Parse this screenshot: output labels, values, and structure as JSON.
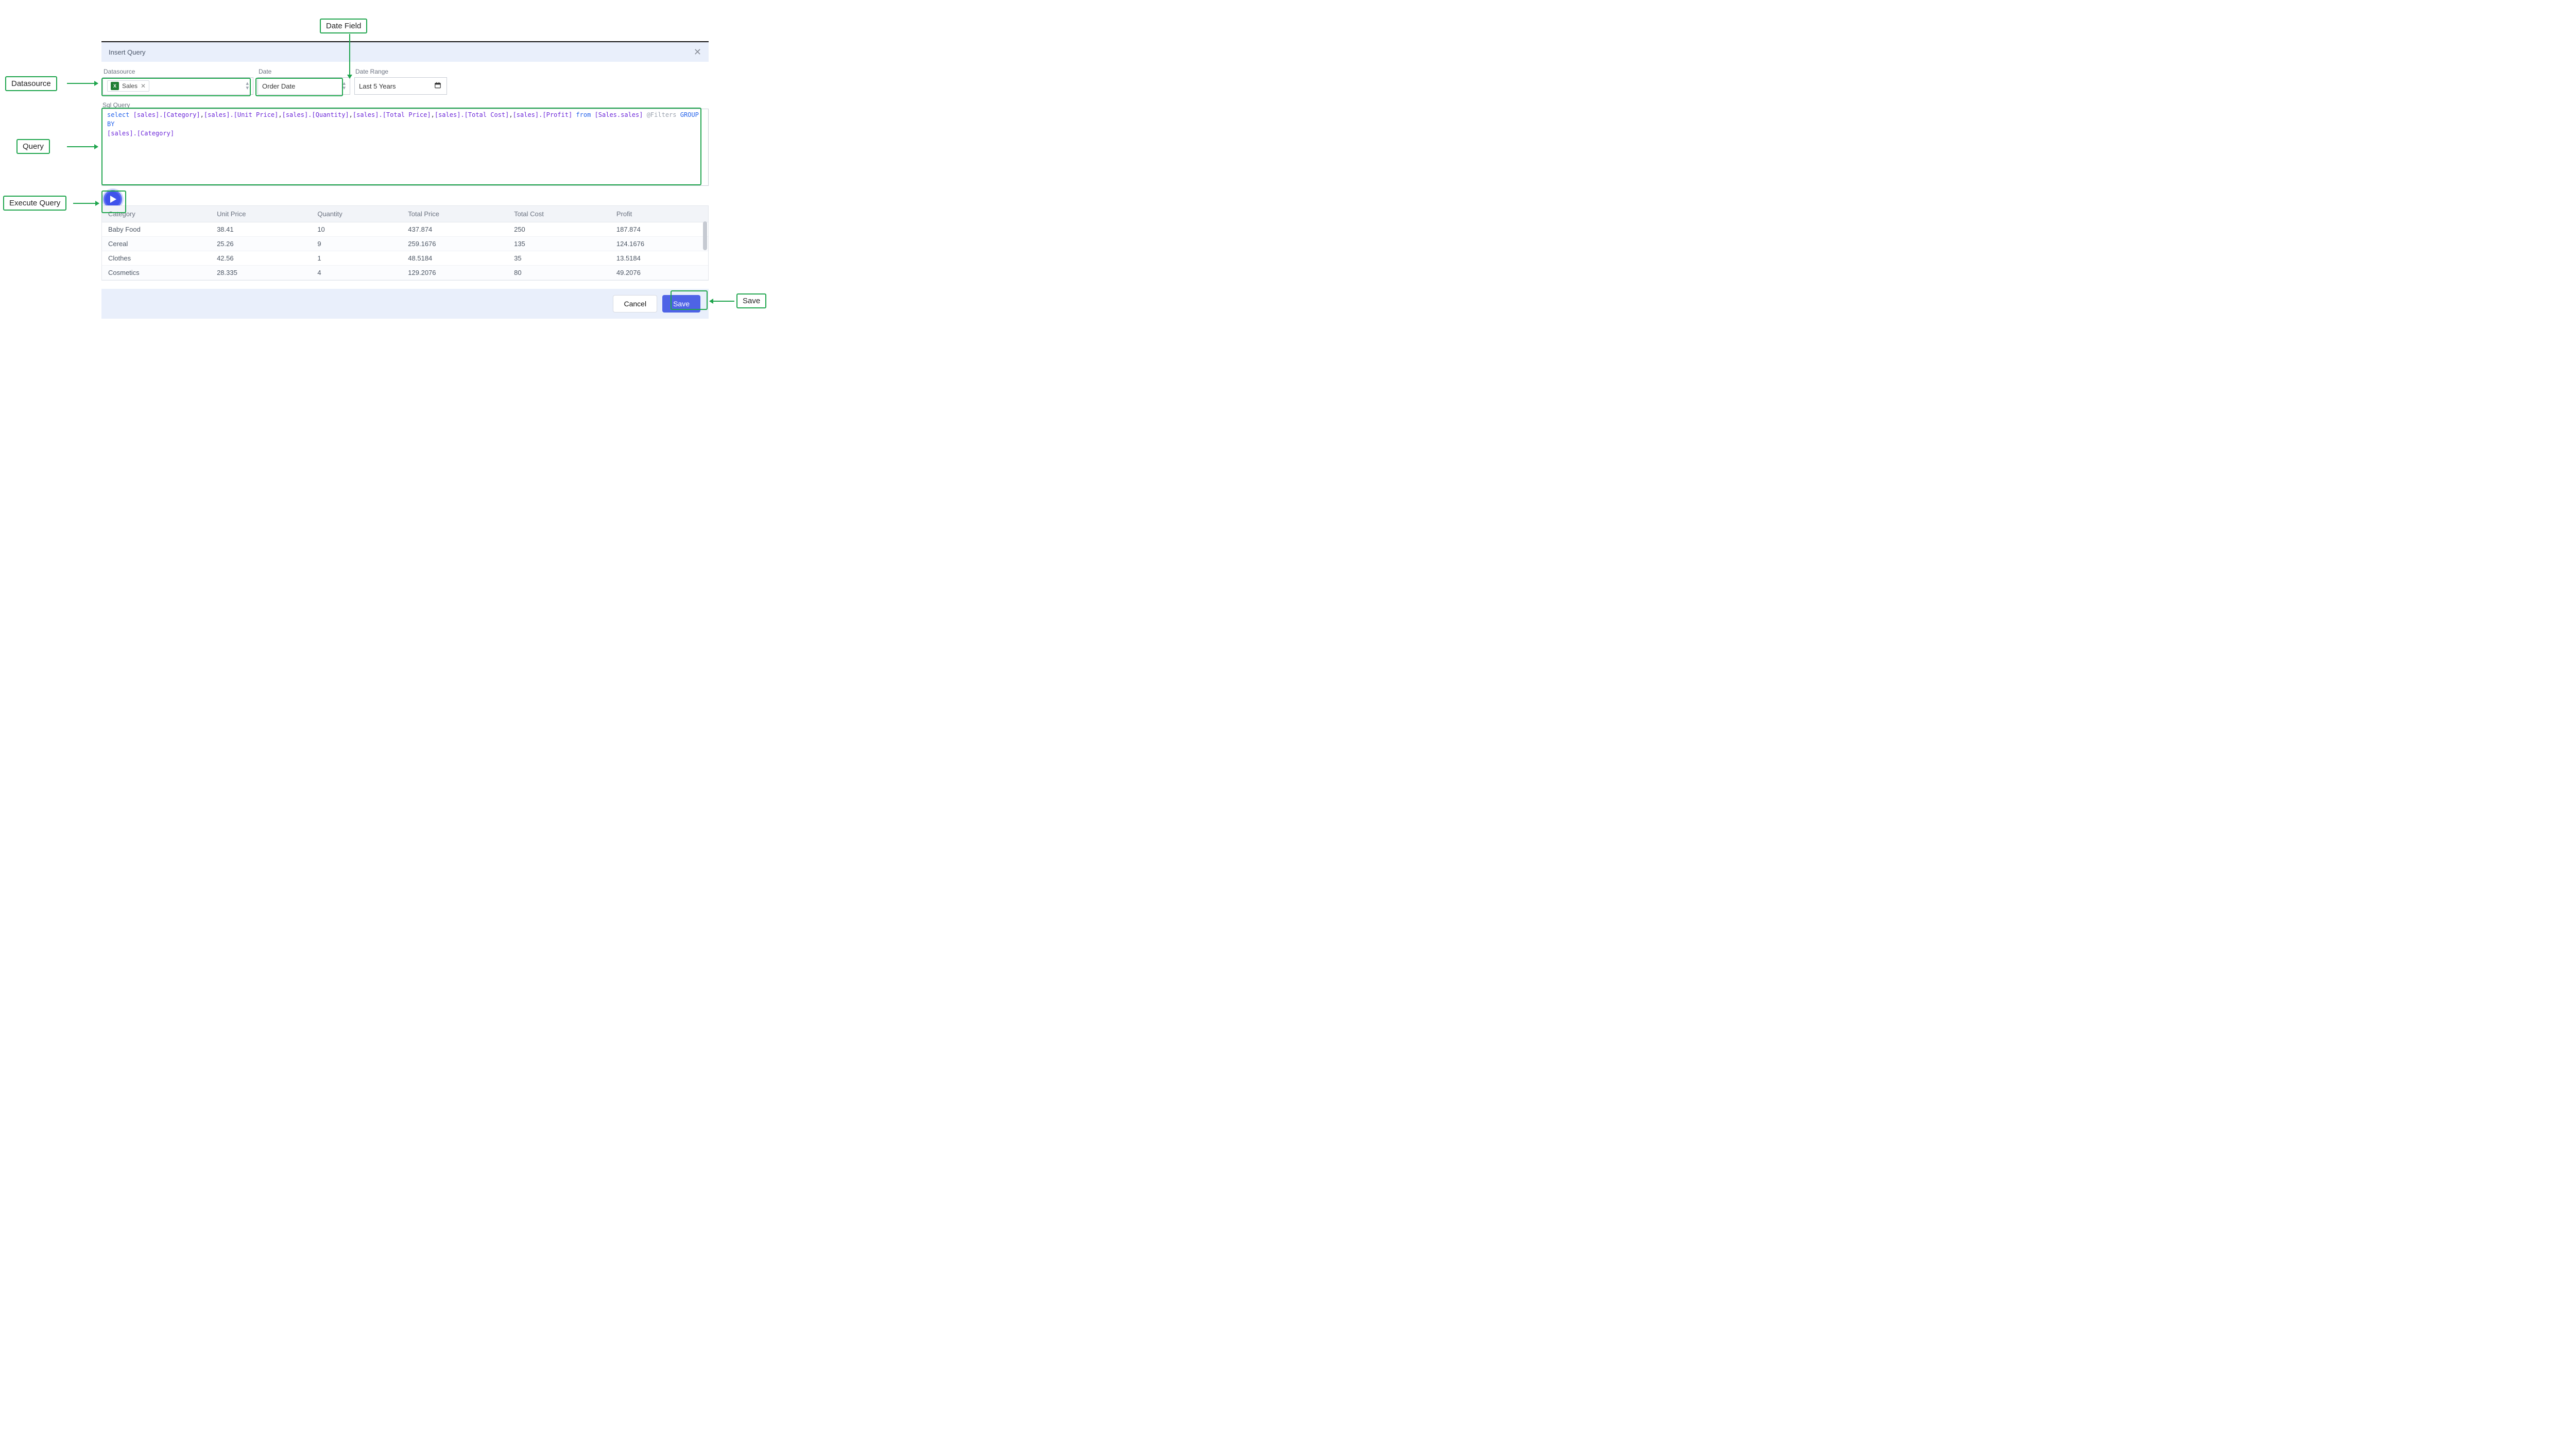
{
  "callouts": {
    "datasource": "Datasource",
    "date_field": "Date Field",
    "query": "Query",
    "execute": "Execute Query",
    "save": "Save"
  },
  "dialog": {
    "title": "Insert Query",
    "fields": {
      "datasource": {
        "label": "Datasource",
        "chip": "Sales"
      },
      "date": {
        "label": "Date",
        "value": "Order Date"
      },
      "daterange": {
        "label": "Date Range",
        "value": "Last 5 Years"
      }
    },
    "sql": {
      "label": "Sql Query",
      "tokens": [
        {
          "t": "kw",
          "v": "select"
        },
        {
          "t": "sp",
          "v": " "
        },
        {
          "t": "br",
          "v": "[sales].[Category]"
        },
        {
          "t": "txt",
          "v": ","
        },
        {
          "t": "br",
          "v": "[sales].[Unit Price]"
        },
        {
          "t": "txt",
          "v": ","
        },
        {
          "t": "br",
          "v": "[sales].[Quantity]"
        },
        {
          "t": "txt",
          "v": ","
        },
        {
          "t": "br",
          "v": "[sales].[Total Price]"
        },
        {
          "t": "txt",
          "v": ","
        },
        {
          "t": "br",
          "v": "[sales].[Total Cost]"
        },
        {
          "t": "txt",
          "v": ","
        },
        {
          "t": "br",
          "v": "[sales].[Profit]"
        },
        {
          "t": "sp",
          "v": " "
        },
        {
          "t": "kw",
          "v": "from"
        },
        {
          "t": "sp",
          "v": " "
        },
        {
          "t": "br",
          "v": "[Sales.sales]"
        },
        {
          "t": "sp",
          "v": " "
        },
        {
          "t": "anno",
          "v": "@Filters"
        },
        {
          "t": "sp",
          "v": " "
        },
        {
          "t": "kw",
          "v": "GROUP BY"
        },
        {
          "t": "nl",
          "v": ""
        },
        {
          "t": "br",
          "v": "[sales].[Category]"
        }
      ]
    },
    "grid": {
      "columns": [
        "Category",
        "Unit Price",
        "Quantity",
        "Total Price",
        "Total Cost",
        "Profit"
      ],
      "rows": [
        [
          "Baby Food",
          "38.41",
          "10",
          "437.874",
          "250",
          "187.874"
        ],
        [
          "Cereal",
          "25.26",
          "9",
          "259.1676",
          "135",
          "124.1676"
        ],
        [
          "Clothes",
          "42.56",
          "1",
          "48.5184",
          "35",
          "13.5184"
        ],
        [
          "Cosmetics",
          "28.335",
          "4",
          "129.2076",
          "80",
          "49.2076"
        ]
      ]
    },
    "footer": {
      "cancel": "Cancel",
      "save": "Save"
    }
  }
}
